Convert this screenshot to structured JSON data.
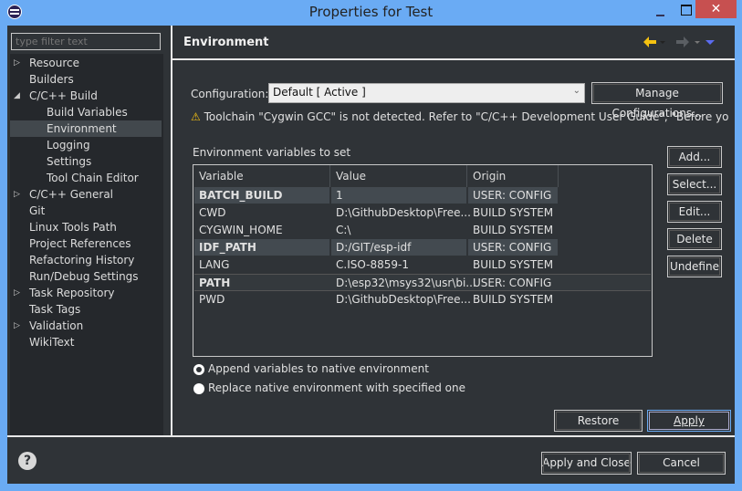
{
  "window": {
    "title": "Properties for Test",
    "close_glyph": "✕"
  },
  "sidebar": {
    "filter_placeholder": "type filter text",
    "items": [
      {
        "label": "Resource",
        "level": 0,
        "twisty": "collapsed"
      },
      {
        "label": "Builders",
        "level": 0,
        "twisty": "none"
      },
      {
        "label": "C/C++ Build",
        "level": 0,
        "twisty": "expanded"
      },
      {
        "label": "Build Variables",
        "level": 1,
        "twisty": "none"
      },
      {
        "label": "Environment",
        "level": 1,
        "twisty": "none",
        "selected": true
      },
      {
        "label": "Logging",
        "level": 1,
        "twisty": "none"
      },
      {
        "label": "Settings",
        "level": 1,
        "twisty": "none"
      },
      {
        "label": "Tool Chain Editor",
        "level": 1,
        "twisty": "none"
      },
      {
        "label": "C/C++ General",
        "level": 0,
        "twisty": "collapsed"
      },
      {
        "label": "Git",
        "level": 0,
        "twisty": "none"
      },
      {
        "label": "Linux Tools Path",
        "level": 0,
        "twisty": "none"
      },
      {
        "label": "Project References",
        "level": 0,
        "twisty": "none"
      },
      {
        "label": "Refactoring History",
        "level": 0,
        "twisty": "none"
      },
      {
        "label": "Run/Debug Settings",
        "level": 0,
        "twisty": "none"
      },
      {
        "label": "Task Repository",
        "level": 0,
        "twisty": "collapsed"
      },
      {
        "label": "Task Tags",
        "level": 0,
        "twisty": "none"
      },
      {
        "label": "Validation",
        "level": 0,
        "twisty": "collapsed"
      },
      {
        "label": "WikiText",
        "level": 0,
        "twisty": "none"
      }
    ]
  },
  "page": {
    "title": "Environment",
    "nav": {
      "back_icon": "arrow-left",
      "forward_icon": "arrow-right",
      "menu_icon": "chevron-down",
      "back_color": "#f5c211",
      "menu_color": "#5b6cf0"
    },
    "config_label": "Configuration:",
    "config_value": "Default  [ Active ]",
    "manage_button": "Manage Configurations...",
    "warning": "Toolchain \"Cygwin GCC\" is not detected. Refer to \"C/C++ Development User Guide\", \"Before you begin\" h",
    "table_label": "Environment variables to set",
    "columns": [
      "Variable",
      "Value",
      "Origin"
    ],
    "rows": [
      {
        "variable": "BATCH_BUILD",
        "value": "1",
        "origin": "USER: CONFIG",
        "user": true
      },
      {
        "variable": "CWD",
        "value": "D:\\GithubDesktop\\Free...",
        "origin": "BUILD SYSTEM",
        "user": false
      },
      {
        "variable": "CYGWIN_HOME",
        "value": "C:\\",
        "origin": "BUILD SYSTEM",
        "user": false
      },
      {
        "variable": "IDF_PATH",
        "value": "D:/GIT/esp-idf",
        "origin": "USER: CONFIG",
        "user": true
      },
      {
        "variable": "LANG",
        "value": "C.ISO-8859-1",
        "origin": "BUILD SYSTEM",
        "user": false
      },
      {
        "variable": "PATH",
        "value": "D:\\esp32\\msys32\\usr\\bi...",
        "origin": "USER: CONFIG",
        "user": true,
        "focused": true
      },
      {
        "variable": "PWD",
        "value": "D:\\GithubDesktop\\Free...",
        "origin": "BUILD SYSTEM",
        "user": false
      }
    ],
    "side_buttons": [
      "Add...",
      "Select...",
      "Edit...",
      "Delete",
      "Undefine"
    ],
    "radio": [
      {
        "label": "Append variables to native environment",
        "checked": true
      },
      {
        "label": "Replace native environment with specified one",
        "checked": false
      }
    ],
    "restore_defaults": "Restore Defaults",
    "apply": "Apply"
  },
  "footer": {
    "help": "?",
    "apply_close": "Apply and Close",
    "cancel": "Cancel"
  }
}
